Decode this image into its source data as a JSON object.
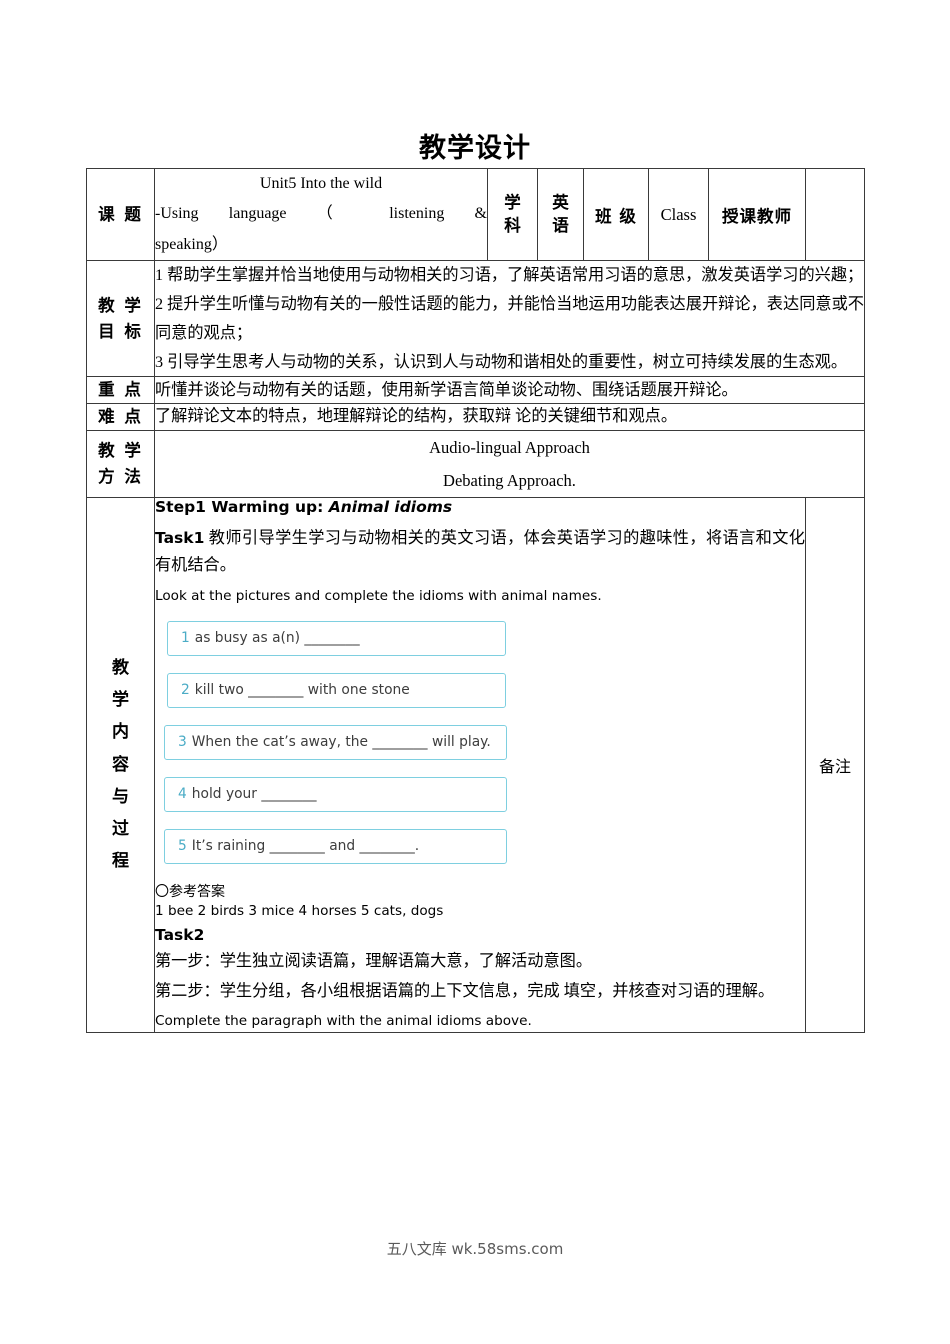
{
  "document": {
    "title": "教学设计"
  },
  "table": {
    "row_topic": {
      "label": "课 题",
      "topic_line1": "Unit5 Into the wild",
      "topic_line2": "-Using language （ listening &",
      "topic_line3": "speaking）",
      "subject_label": "学科",
      "subject_value": "英语",
      "class_label": "班 级",
      "class_value": "Class",
      "teacher_label": "授课教师",
      "teacher_value": ""
    },
    "row_objectives": {
      "label": "教 学 目 标",
      "items": [
        "1 帮助学生掌握并恰当地使用与动物相关的习语，了解英语常用习语的意思，激发英语学习的兴趣；",
        "2 提升学生听懂与动物有关的一般性话题的能力，并能恰当地运用功能表达展开辩论，表达同意或不同意的观点；",
        "3 引导学生思考人与动物的关系，认识到人与动物和谐相处的重要性，树立可持续发展的生态观。"
      ]
    },
    "row_keypoints": {
      "label": "重 点",
      "text": "听懂并谈论与动物有关的话题，使用新学语言简单谈论动物、围绕话题展开辩论。"
    },
    "row_difficulty": {
      "label": "难 点",
      "text": "了解辩论文本的特点，地理解辩论的结构，获取辩 论的关键细节和观点。"
    },
    "row_methods": {
      "label": "教 学 方 法",
      "lines": [
        "Audio-lingual Approach",
        "Debating Approach."
      ]
    },
    "row_content": {
      "label": "教学内容与过程",
      "label_chars": [
        "教",
        "学",
        "内",
        "容",
        "与",
        "过",
        "程"
      ],
      "remark_label": "备注"
    }
  },
  "content": {
    "step1_heading_plain": "Step1 Warming up: ",
    "step1_heading_italic": "Animal idioms",
    "task1_label": "Task1",
    "task1_text": " 教师引导学生学习与动物相关的英文习语，体会英语学习的趣味性，将语言和文化有机结合。",
    "task1_instruction": "Look at the pictures and complete the idioms with animal names.",
    "idioms": [
      {
        "num": "1",
        "text": "as busy as a(n) ________"
      },
      {
        "num": "2",
        "text": "kill two ________ with one stone"
      },
      {
        "num": "3",
        "text": "When the cat’s away, the ________ will play."
      },
      {
        "num": "4",
        "text": "hold your ________"
      },
      {
        "num": "5",
        "text": "It’s raining ________ and ________."
      }
    ],
    "answer_heading": "〇参考答案",
    "answer_line": "1 bee 2 birds 3 mice 4 horses 5 cats, dogs",
    "task2_label": "Task2",
    "task2_step1": "第一步：学生独立阅读语篇，理解语篇大意，了解活动意图。",
    "task2_step2": "第二步：学生分组，各小组根据语篇的上下文信息，完成 填空，并核查对习语的理解。",
    "task2_instruction": "Complete the paragraph with the animal idioms above."
  },
  "footer": {
    "watermark": "五八文库 wk.58sms.com"
  },
  "colors": {
    "box_border": "#7ecfe0",
    "box_number": "#4bacc6",
    "table_border": "#3a3a3a"
  }
}
